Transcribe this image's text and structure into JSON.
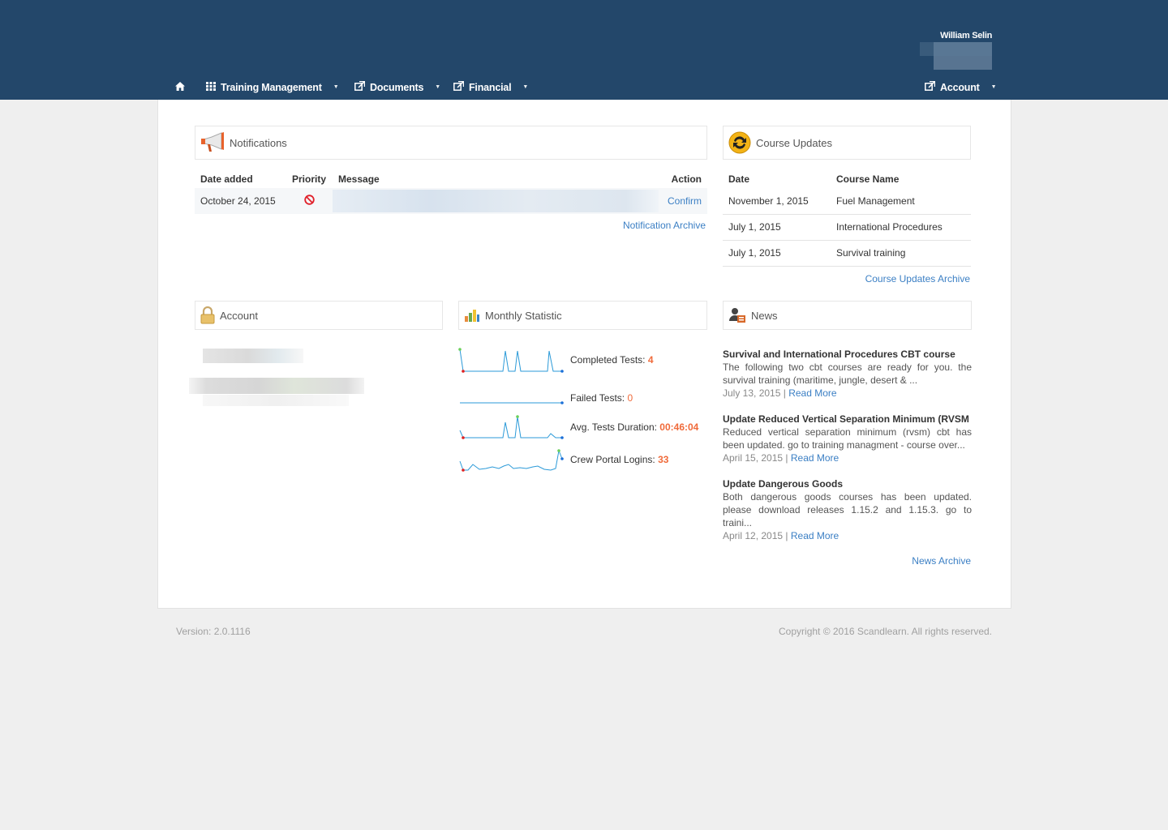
{
  "header": {
    "user_name": "William Selin"
  },
  "nav": {
    "home_icon": "home-icon",
    "items": [
      {
        "label": "Training Management",
        "icon": "grid-icon"
      },
      {
        "label": "Documents",
        "icon": "external-link-icon"
      },
      {
        "label": "Financial",
        "icon": "external-link-icon"
      }
    ],
    "account": {
      "label": "Account",
      "icon": "external-link-icon"
    }
  },
  "notifications": {
    "title": "Notifications",
    "columns": [
      "Date added",
      "Priority",
      "Message",
      "Action"
    ],
    "rows": [
      {
        "date": "October 24, 2015",
        "priority_icon": "no-entry-icon",
        "action": "Confirm"
      }
    ],
    "archive_link": "Notification Archive"
  },
  "course_updates": {
    "title": "Course Updates",
    "columns": [
      "Date",
      "Course Name"
    ],
    "rows": [
      {
        "date": "November 1, 2015",
        "course": "Fuel Management"
      },
      {
        "date": "July 1, 2015",
        "course": "International Procedures"
      },
      {
        "date": "July 1, 2015",
        "course": "Survival training"
      }
    ],
    "archive_link": "Course Updates Archive"
  },
  "account_box": {
    "title": "Account"
  },
  "monthly_statistic": {
    "title": "Monthly Statistic",
    "stats": [
      {
        "label": "Completed Tests:",
        "value": "4"
      },
      {
        "label": "Failed Tests:",
        "value": "0"
      },
      {
        "label": "Avg. Tests Duration:",
        "value": "00:46:04"
      },
      {
        "label": "Crew Portal Logins:",
        "value": "33"
      }
    ]
  },
  "news": {
    "title": "News",
    "items": [
      {
        "title": "Survival and International Procedures CBT course",
        "body": "The following two cbt courses are ready for you. the survival training (maritime, jungle, desert & ...",
        "date": "July 13, 2015",
        "link": "Read More"
      },
      {
        "title": "Update Reduced Vertical Separation Minimum (RVSM",
        "body": "Reduced vertical separation minimum (rvsm) cbt has been updated. go to training managment - course over...",
        "date": "April 15, 2015",
        "link": "Read More"
      },
      {
        "title": "Update Dangerous Goods",
        "body": "Both dangerous goods courses has been updated. please download releases 1.15.2 and 1.15.3. go to traini...",
        "date": "April 12, 2015",
        "link": "Read More"
      }
    ],
    "archive_link": "News Archive"
  },
  "footer": {
    "version": "Version: 2.0.1116",
    "copyright": "Copyright © 2016 Scandlearn. All rights reserved."
  },
  "colors": {
    "header_bg": "#23476a",
    "accent_link": "#3b7fc4",
    "stat_value": "#f06a3a",
    "sparkline": "#2b9ad8"
  }
}
